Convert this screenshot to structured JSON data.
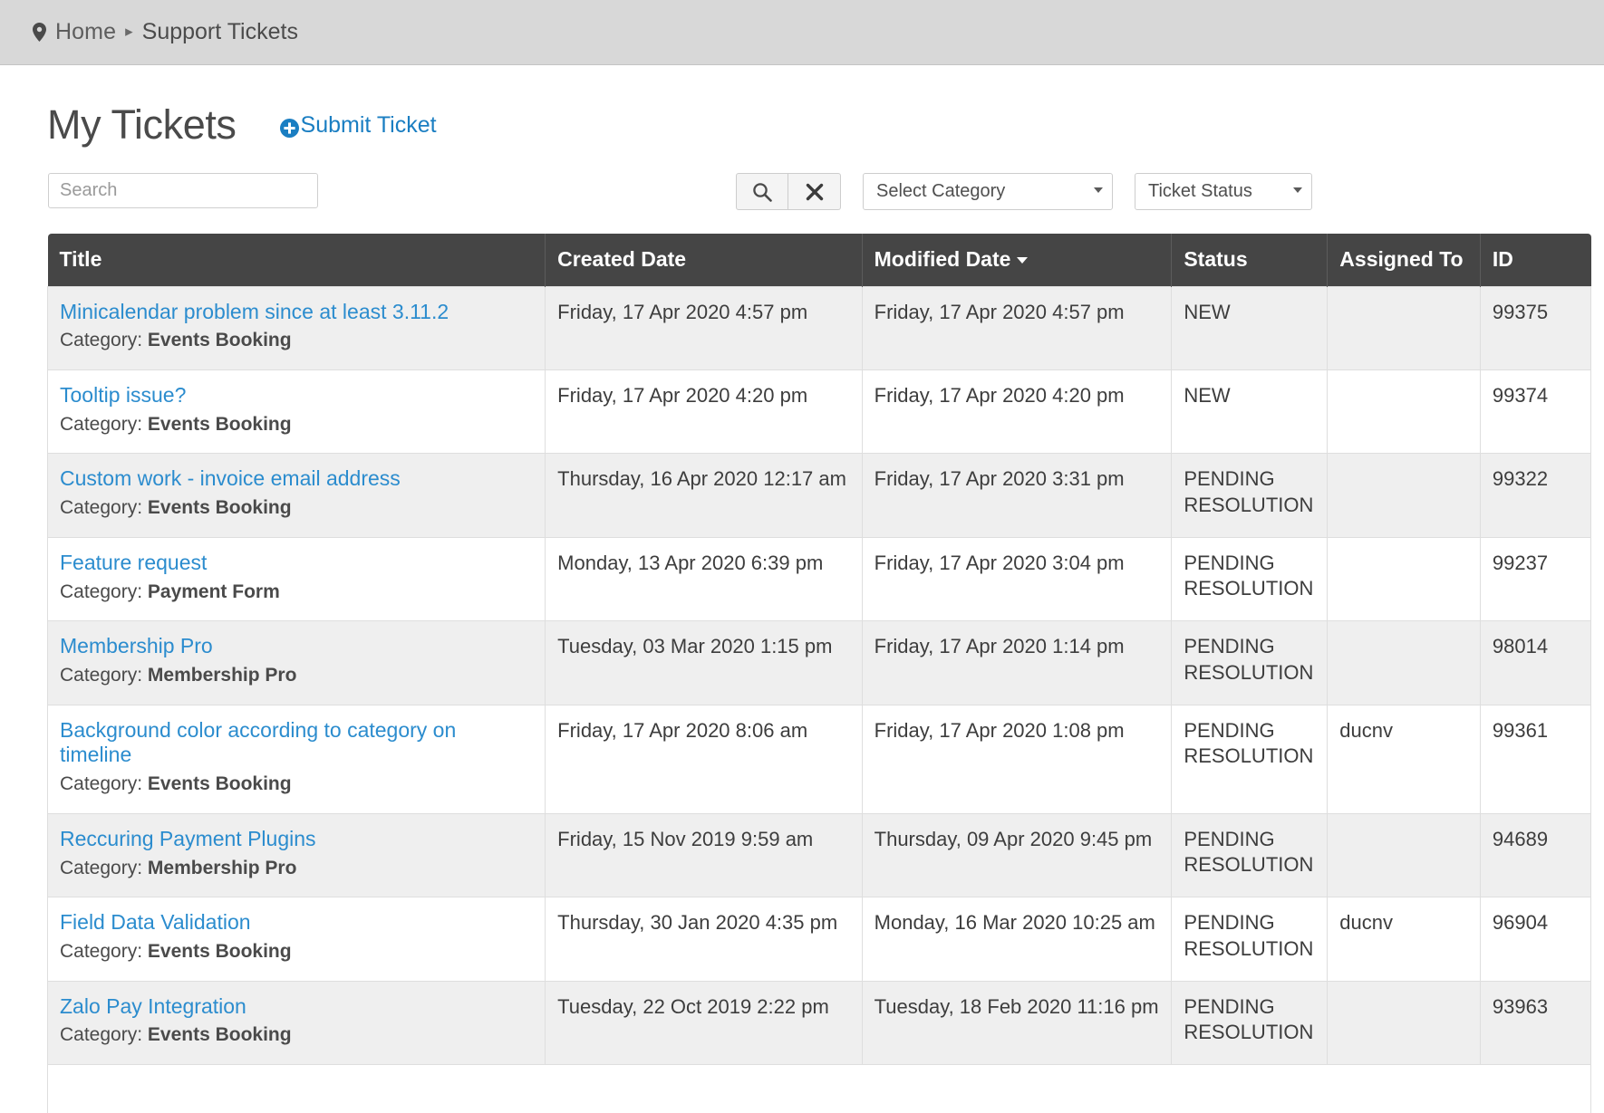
{
  "breadcrumb": {
    "pin_icon": "location-pin-icon",
    "home": "Home",
    "separator": "▸",
    "current": "Support Tickets"
  },
  "header": {
    "title": "My Tickets",
    "submit_label": "Submit Ticket",
    "submit_icon": "plus-circle-icon"
  },
  "toolbar": {
    "search_placeholder": "Search",
    "search_value": "",
    "search_button_icon": "search-icon",
    "clear_button_icon": "close-x-icon",
    "category_select": "Select Category",
    "status_select": "Ticket Status"
  },
  "colors": {
    "link": "#2b8cce",
    "header_bg": "#454545",
    "row_alt_bg": "#efefef",
    "breadcrumb_bg": "#d8d8d8"
  },
  "table": {
    "columns": [
      {
        "key": "title",
        "label": "Title"
      },
      {
        "key": "created",
        "label": "Created Date"
      },
      {
        "key": "modified",
        "label": "Modified Date",
        "sorted": "desc"
      },
      {
        "key": "status",
        "label": "Status"
      },
      {
        "key": "assigned",
        "label": "Assigned To"
      },
      {
        "key": "id",
        "label": "ID"
      }
    ],
    "category_prefix": "Category:",
    "rows": [
      {
        "title": "Minicalendar problem since at least 3.11.2",
        "category": "Events Booking",
        "created": "Friday, 17 Apr 2020 4:57 pm",
        "modified": "Friday, 17 Apr 2020 4:57 pm",
        "status": "NEW",
        "assigned": "",
        "id": "99375"
      },
      {
        "title": "Tooltip issue?",
        "category": "Events Booking",
        "created": "Friday, 17 Apr 2020 4:20 pm",
        "modified": "Friday, 17 Apr 2020 4:20 pm",
        "status": "NEW",
        "assigned": "",
        "id": "99374"
      },
      {
        "title": "Custom work - invoice email address",
        "category": "Events Booking",
        "created": "Thursday, 16 Apr 2020 12:17 am",
        "modified": "Friday, 17 Apr 2020 3:31 pm",
        "status": "PENDING RESOLUTION",
        "assigned": "",
        "id": "99322"
      },
      {
        "title": "Feature request",
        "category": "Payment Form",
        "created": "Monday, 13 Apr 2020 6:39 pm",
        "modified": "Friday, 17 Apr 2020 3:04 pm",
        "status": "PENDING RESOLUTION",
        "assigned": "",
        "id": "99237"
      },
      {
        "title": "Membership Pro",
        "category": "Membership Pro",
        "created": "Tuesday, 03 Mar 2020 1:15 pm",
        "modified": "Friday, 17 Apr 2020 1:14 pm",
        "status": "PENDING RESOLUTION",
        "assigned": "",
        "id": "98014"
      },
      {
        "title": "Background color according to category on timeline",
        "category": "Events Booking",
        "created": "Friday, 17 Apr 2020 8:06 am",
        "modified": "Friday, 17 Apr 2020 1:08 pm",
        "status": "PENDING RESOLUTION",
        "assigned": "ducnv",
        "id": "99361"
      },
      {
        "title": "Reccuring Payment Plugins",
        "category": "Membership Pro",
        "created": "Friday, 15 Nov 2019 9:59 am",
        "modified": "Thursday, 09 Apr 2020 9:45 pm",
        "status": "PENDING RESOLUTION",
        "assigned": "",
        "id": "94689"
      },
      {
        "title": "Field Data Validation",
        "category": "Events Booking",
        "created": "Thursday, 30 Jan 2020 4:35 pm",
        "modified": "Monday, 16 Mar 2020 10:25 am",
        "status": "PENDING RESOLUTION",
        "assigned": "ducnv",
        "id": "96904"
      },
      {
        "title": "Zalo Pay Integration",
        "category": "Events Booking",
        "created": "Tuesday, 22 Oct 2019 2:22 pm",
        "modified": "Tuesday, 18 Feb 2020 11:16 pm",
        "status": "PENDING RESOLUTION",
        "assigned": "",
        "id": "93963"
      }
    ]
  }
}
